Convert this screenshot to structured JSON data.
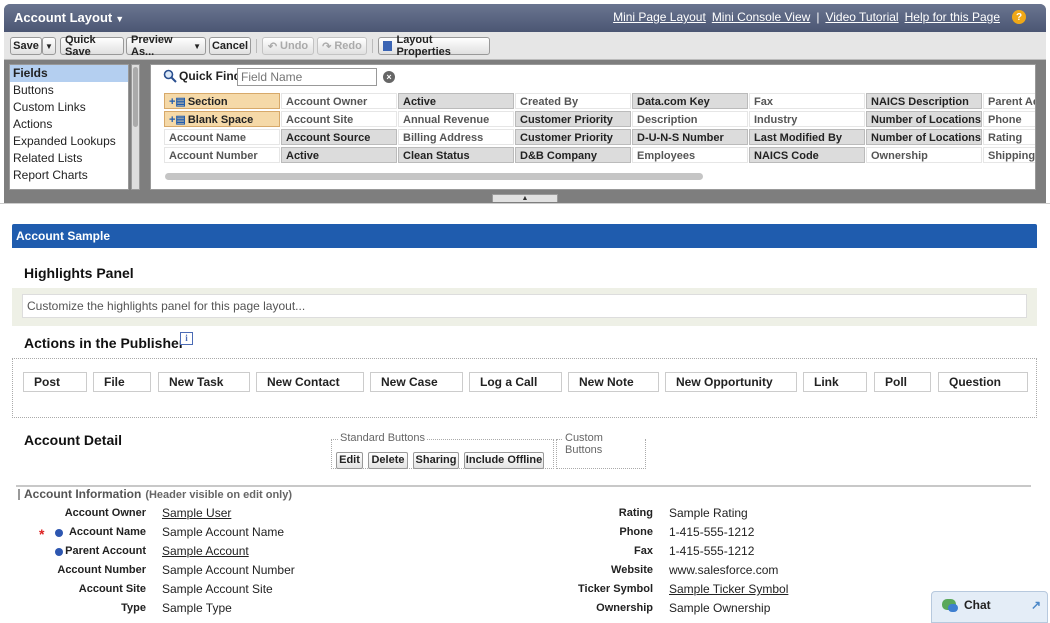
{
  "header": {
    "title": "Account Layout",
    "links": [
      "Mini Page Layout",
      "Mini Console View",
      "Video Tutorial",
      "Help for this Page"
    ],
    "separator": "|"
  },
  "toolbar": {
    "save": "Save",
    "quick_save": "Quick Save",
    "preview_as": "Preview As...",
    "cancel": "Cancel",
    "undo": "Undo",
    "redo": "Redo",
    "layout_properties": "Layout Properties"
  },
  "palette": {
    "categories": [
      "Fields",
      "Buttons",
      "Custom Links",
      "Actions",
      "Expanded Lookups",
      "Related Lists",
      "Report Charts"
    ],
    "selected_category": "Fields",
    "quick_find_label": "Quick Find",
    "quick_find_placeholder": "Field Name",
    "fields": [
      [
        "Section",
        "Account Owner",
        "Active",
        "Created By",
        "Data.com Key",
        "Fax",
        "NAICS Description",
        "Parent Ac"
      ],
      [
        "Blank Space",
        "Account Site",
        "Annual Revenue",
        "Customer Priority",
        "Description",
        "Industry",
        "Number of Locations",
        "Phone"
      ],
      [
        "Account Name",
        "Account Source",
        "Billing Address",
        "Customer Priority",
        "D-U-N-S Number",
        "Last Modified By",
        "Number of Locations",
        "Rating"
      ],
      [
        "Account Number",
        "Active",
        "Clean Status",
        "D&B Company",
        "Employees",
        "NAICS Code",
        "Ownership",
        "Shipping A"
      ]
    ]
  },
  "layout": {
    "sample_title": "Account Sample",
    "highlights_title": "Highlights Panel",
    "highlights_text": "Customize the highlights panel for this page layout...",
    "publisher_title": "Actions in the Publisher",
    "publisher_actions": [
      "Post",
      "File",
      "New Task",
      "New Contact",
      "New Case",
      "Log a Call",
      "New Note",
      "New Opportunity",
      "Link",
      "Poll",
      "Question"
    ],
    "detail_title": "Account Detail",
    "standard_buttons_legend": "Standard Buttons",
    "standard_buttons": [
      "Edit",
      "Delete",
      "Sharing",
      "Include Offline"
    ],
    "custom_buttons_legend": "Custom Buttons",
    "section_title": "Account Information",
    "section_note": "(Header visible on edit only)",
    "left_fields": [
      {
        "label": "Account Owner",
        "value": "Sample User"
      },
      {
        "label": "Account Name",
        "value": "Sample Account Name"
      },
      {
        "label": "Parent Account",
        "value": "Sample Account"
      },
      {
        "label": "Account Number",
        "value": "Sample Account Number"
      },
      {
        "label": "Account Site",
        "value": "Sample Account Site"
      },
      {
        "label": "Type",
        "value": "Sample Type"
      }
    ],
    "right_fields": [
      {
        "label": "Rating",
        "value": "Sample Rating"
      },
      {
        "label": "Phone",
        "value": "1-415-555-1212"
      },
      {
        "label": "Fax",
        "value": "1-415-555-1212"
      },
      {
        "label": "Website",
        "value": "www.salesforce.com"
      },
      {
        "label": "Ticker Symbol",
        "value": "Sample Ticker Symbol"
      },
      {
        "label": "Ownership",
        "value": "Sample Ownership"
      }
    ],
    "required_marker": "*"
  },
  "chat": {
    "label": "Chat"
  },
  "icons": {
    "help": "help-icon",
    "search": "search-icon",
    "clear": "clear-icon",
    "info": "info-icon",
    "undo": "undo-icon",
    "redo": "redo-icon"
  },
  "colors": {
    "title_bar": "#4b5673",
    "sample_bar": "#1f5cae",
    "selected_item": "#b4cff0",
    "special_field": "#f5d9a8"
  }
}
